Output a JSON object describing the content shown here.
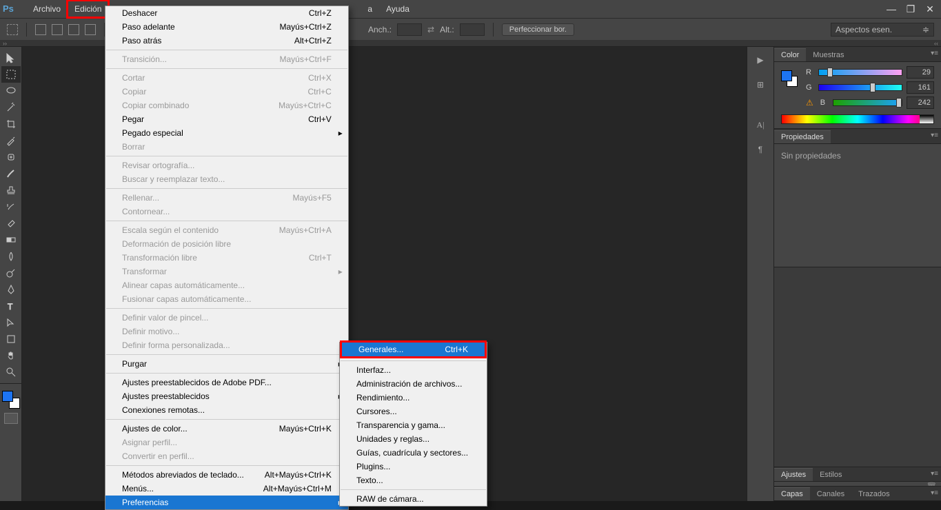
{
  "app": {
    "logo": "Ps"
  },
  "menubar": {
    "items": [
      "Archivo",
      "Edición",
      "a",
      "Ayuda"
    ],
    "highlighted_index": 1
  },
  "window_controls": {
    "min": "—",
    "max": "❐",
    "close": "✕"
  },
  "options_bar": {
    "anch_label": "Anch.:",
    "alt_label": "Alt.:",
    "refine_btn": "Perfeccionar bor.",
    "workspace": "Aspectos esen."
  },
  "edit_menu": {
    "groups": [
      [
        {
          "label": "Deshacer",
          "shortcut": "Ctrl+Z"
        },
        {
          "label": "Paso adelante",
          "shortcut": "Mayús+Ctrl+Z"
        },
        {
          "label": "Paso atrás",
          "shortcut": "Alt+Ctrl+Z"
        }
      ],
      [
        {
          "label": "Transición...",
          "shortcut": "Mayús+Ctrl+F",
          "disabled": true
        }
      ],
      [
        {
          "label": "Cortar",
          "shortcut": "Ctrl+X",
          "disabled": true
        },
        {
          "label": "Copiar",
          "shortcut": "Ctrl+C",
          "disabled": true
        },
        {
          "label": "Copiar combinado",
          "shortcut": "Mayús+Ctrl+C",
          "disabled": true
        },
        {
          "label": "Pegar",
          "shortcut": "Ctrl+V"
        },
        {
          "label": "Pegado especial",
          "submenu": true
        },
        {
          "label": "Borrar",
          "disabled": true
        }
      ],
      [
        {
          "label": "Revisar ortografía...",
          "disabled": true
        },
        {
          "label": "Buscar y reemplazar texto...",
          "disabled": true
        }
      ],
      [
        {
          "label": "Rellenar...",
          "shortcut": "Mayús+F5",
          "disabled": true
        },
        {
          "label": "Contornear...",
          "disabled": true
        }
      ],
      [
        {
          "label": "Escala según el contenido",
          "shortcut": "Mayús+Ctrl+A",
          "disabled": true
        },
        {
          "label": "Deformación de posición libre",
          "disabled": true
        },
        {
          "label": "Transformación libre",
          "shortcut": "Ctrl+T",
          "disabled": true
        },
        {
          "label": "Transformar",
          "submenu": true,
          "disabled": true
        },
        {
          "label": "Alinear capas automáticamente...",
          "disabled": true
        },
        {
          "label": "Fusionar capas automáticamente...",
          "disabled": true
        }
      ],
      [
        {
          "label": "Definir valor de pincel...",
          "disabled": true
        },
        {
          "label": "Definir motivo...",
          "disabled": true
        },
        {
          "label": "Definir forma personalizada...",
          "disabled": true
        }
      ],
      [
        {
          "label": "Purgar",
          "submenu": true
        }
      ],
      [
        {
          "label": "Ajustes preestablecidos de Adobe PDF..."
        },
        {
          "label": "Ajustes preestablecidos",
          "submenu": true
        },
        {
          "label": "Conexiones remotas..."
        }
      ],
      [
        {
          "label": "Ajustes de color...",
          "shortcut": "Mayús+Ctrl+K"
        },
        {
          "label": "Asignar perfil...",
          "disabled": true
        },
        {
          "label": "Convertir en perfil...",
          "disabled": true
        }
      ],
      [
        {
          "label": "Métodos abreviados de teclado...",
          "shortcut": "Alt+Mayús+Ctrl+K"
        },
        {
          "label": "Menús...",
          "shortcut": "Alt+Mayús+Ctrl+M"
        },
        {
          "label": "Preferencias",
          "submenu": true,
          "highlighted": true
        }
      ]
    ]
  },
  "prefs_submenu": {
    "groups": [
      [
        {
          "label": "Generales...",
          "shortcut": "Ctrl+K",
          "highlighted": true,
          "boxed": true
        }
      ],
      [
        {
          "label": "Interfaz..."
        },
        {
          "label": "Administración de archivos..."
        },
        {
          "label": "Rendimiento..."
        },
        {
          "label": "Cursores..."
        },
        {
          "label": "Transparencia y gama..."
        },
        {
          "label": "Unidades y reglas..."
        },
        {
          "label": "Guías, cuadrícula y sectores..."
        },
        {
          "label": "Plugins..."
        },
        {
          "label": "Texto..."
        }
      ],
      [
        {
          "label": "RAW de cámara..."
        }
      ]
    ]
  },
  "color_panel": {
    "tabs": [
      "Color",
      "Muestras"
    ],
    "r_label": "R",
    "r_val": "29",
    "g_label": "G",
    "g_val": "161",
    "b_label": "B",
    "b_val": "242"
  },
  "props_panel": {
    "tab": "Propiedades",
    "text": "Sin propiedades"
  },
  "adjust_tabs": [
    "Ajustes",
    "Estilos"
  ],
  "layers_tabs": [
    "Capas",
    "Canales",
    "Trazados"
  ]
}
